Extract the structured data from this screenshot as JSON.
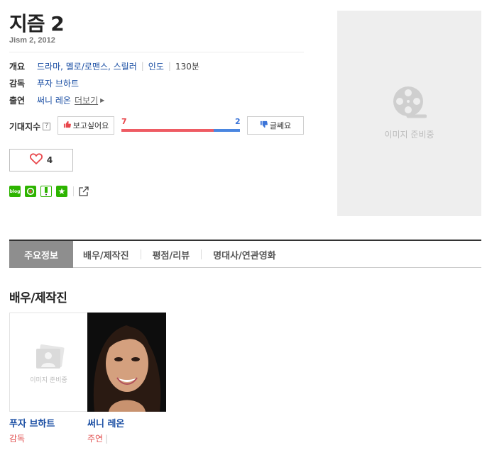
{
  "movie": {
    "title": "지즘 2",
    "subtitle": "Jism 2, 2012"
  },
  "info": {
    "overview_label": "개요",
    "genres": "드라마, 멜로/로맨스, 스릴러",
    "country": "인도",
    "runtime": "130분",
    "director_label": "감독",
    "director": "푸자 브하트",
    "cast_label": "출연",
    "cast": "써니 레온",
    "more_label": "더보기"
  },
  "expect": {
    "label": "기대지수",
    "help": "?",
    "want_label": "보고싶어요",
    "meh_label": "글쎄요",
    "want_count": "7",
    "meh_count": "2",
    "want_ratio": 0.78
  },
  "like": {
    "count": "4"
  },
  "share": {
    "blog_text": "blog",
    "star": "★"
  },
  "poster": {
    "placeholder": "이미지 준비중"
  },
  "tabs": [
    {
      "label": "주요정보"
    },
    {
      "label": "배우/제작진"
    },
    {
      "label": "평점/리뷰"
    },
    {
      "label": "명대사/연관영화"
    }
  ],
  "crew_section": {
    "title": "배우/제작진",
    "people": [
      {
        "name": "푸자 브하트",
        "role": "감독",
        "placeholder": "이미지 준비중"
      },
      {
        "name": "써니 레온",
        "role": "주연"
      }
    ]
  },
  "colors": {
    "link_blue": "#1a4ea3",
    "like_red": "#e8464b",
    "dislike_blue": "#3b74d8",
    "role_red": "#e25454",
    "active_tab": "#8e8e8e"
  }
}
